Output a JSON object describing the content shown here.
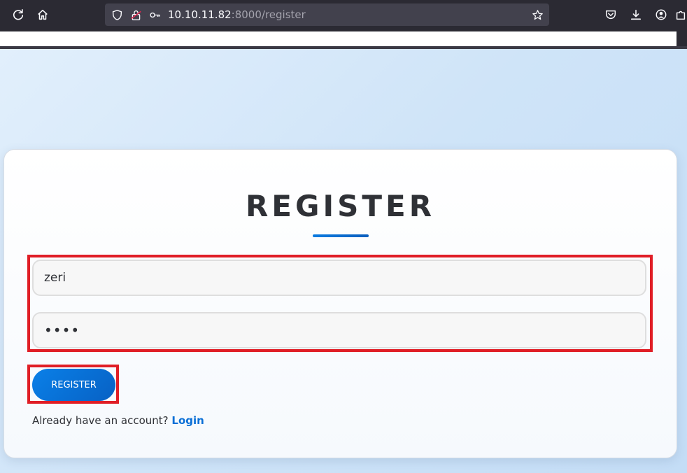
{
  "browser": {
    "url_host": "10.10.11.82",
    "url_rest": ":8000/register"
  },
  "page": {
    "title": "REGISTER",
    "username_value": "zeri",
    "password_value": "••••",
    "register_button": "REGISTER",
    "login_prompt": "Already have an account?",
    "login_link": "Login"
  },
  "icons": {
    "reload": "reload-icon",
    "home": "home-icon",
    "shield": "shield-icon",
    "permissions": "permissions-icon",
    "key": "key-icon",
    "bookmark_star": "star-icon",
    "pocket": "pocket-icon",
    "downloads": "download-icon",
    "account": "account-icon",
    "extensions": "extensions-icon"
  },
  "colors": {
    "accent": "#0a6fd6",
    "highlight": "#e01e26",
    "chrome": "#2b2a33"
  }
}
